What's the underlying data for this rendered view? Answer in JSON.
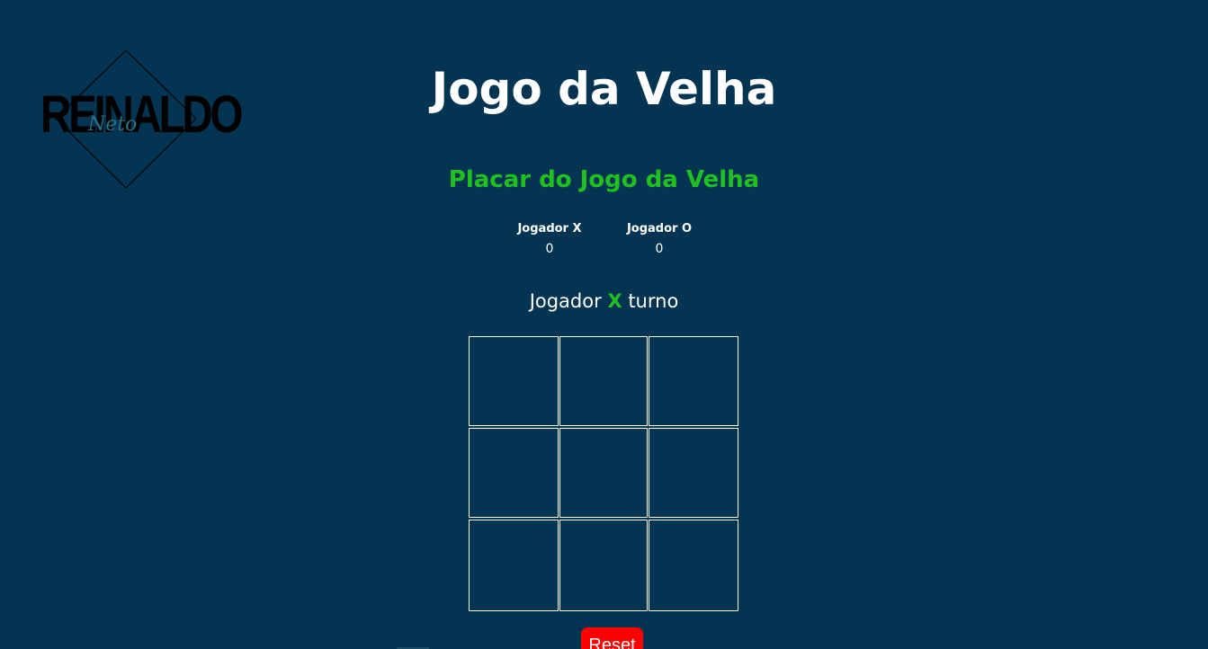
{
  "logo": {
    "word": "REINALDO",
    "script": "Neto"
  },
  "header": {
    "title": "Jogo da Velha"
  },
  "scoreboard": {
    "title": "Placar do Jogo da Velha",
    "player_x": {
      "label": "Jogador X",
      "score": "0"
    },
    "player_o": {
      "label": "Jogador O",
      "score": "0"
    }
  },
  "turn": {
    "prefix": "Jogador",
    "player": "X",
    "suffix": "turno"
  },
  "board": {
    "cells": [
      "",
      "",
      "",
      "",
      "",
      "",
      "",
      "",
      ""
    ]
  },
  "controls": {
    "reset_label": "Reset"
  },
  "colors": {
    "background": "#033552",
    "accent_green": "#20c020",
    "reset_red": "#ff0000",
    "text": "#ffffff"
  }
}
